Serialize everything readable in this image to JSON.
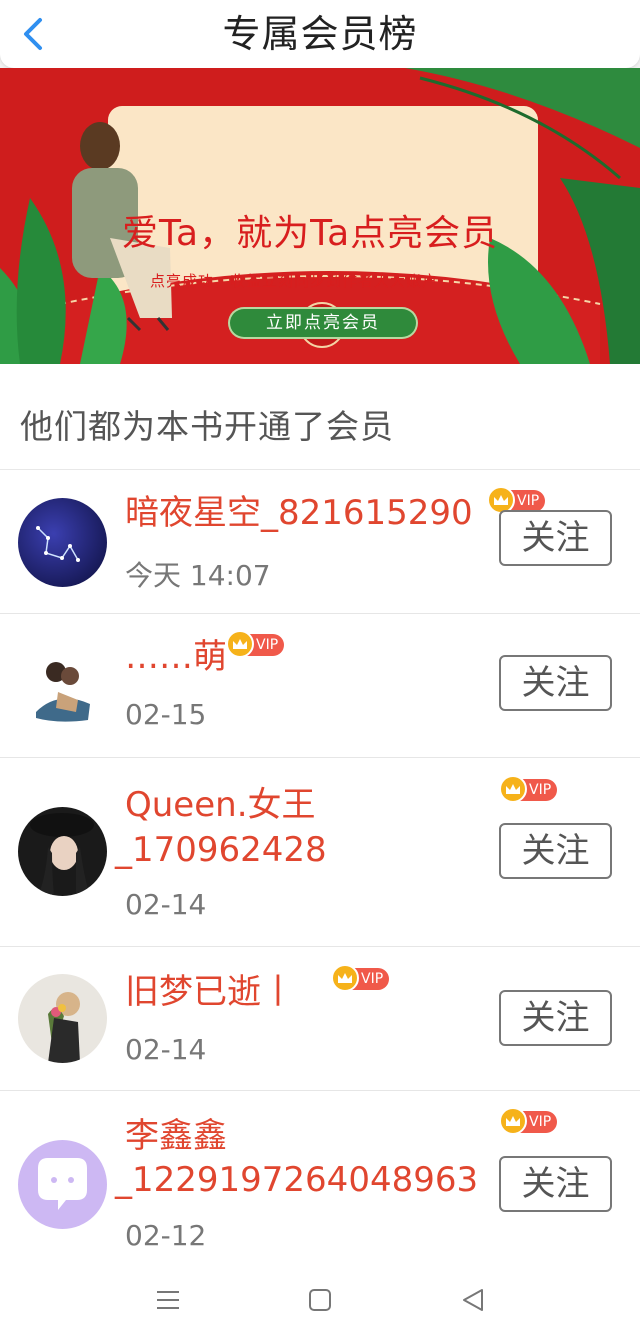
{
  "header": {
    "title": "专属会员榜",
    "back_icon": "chevron-left-icon"
  },
  "banner": {
    "headline": "爱Ta，就为Ta点亮会员",
    "subtitle": "点亮成功，收益立刻同步到作者大大账户",
    "button_label": "立即点亮会员"
  },
  "section": {
    "title": "他们都为本书开通了会员"
  },
  "members": [
    {
      "name": "暗夜星空_821615290",
      "time": "今天 14:07",
      "vip": "VIP",
      "follow": "关注"
    },
    {
      "name": "……萌",
      "time": "02-15",
      "vip": "VIP",
      "follow": "关注"
    },
    {
      "name_line1": "Queen.女王",
      "name_line2": "_170962428",
      "time": "02-14",
      "vip": "VIP",
      "follow": "关注"
    },
    {
      "name": "旧梦已逝丨",
      "time": "02-14",
      "vip": "VIP",
      "follow": "关注"
    },
    {
      "name_line1": "李鑫鑫",
      "name_line2": "_1229197264048963",
      "time": "02-12",
      "vip": "VIP",
      "follow": "关注"
    }
  ],
  "nav": {
    "icons": [
      "menu-icon",
      "home-square-icon",
      "back-triangle-icon"
    ]
  },
  "colors": {
    "accent_red": "#e0462f",
    "banner_red": "#cf1d1d",
    "vip_orange": "#f0594a",
    "header_blue": "#2f8ff0"
  }
}
